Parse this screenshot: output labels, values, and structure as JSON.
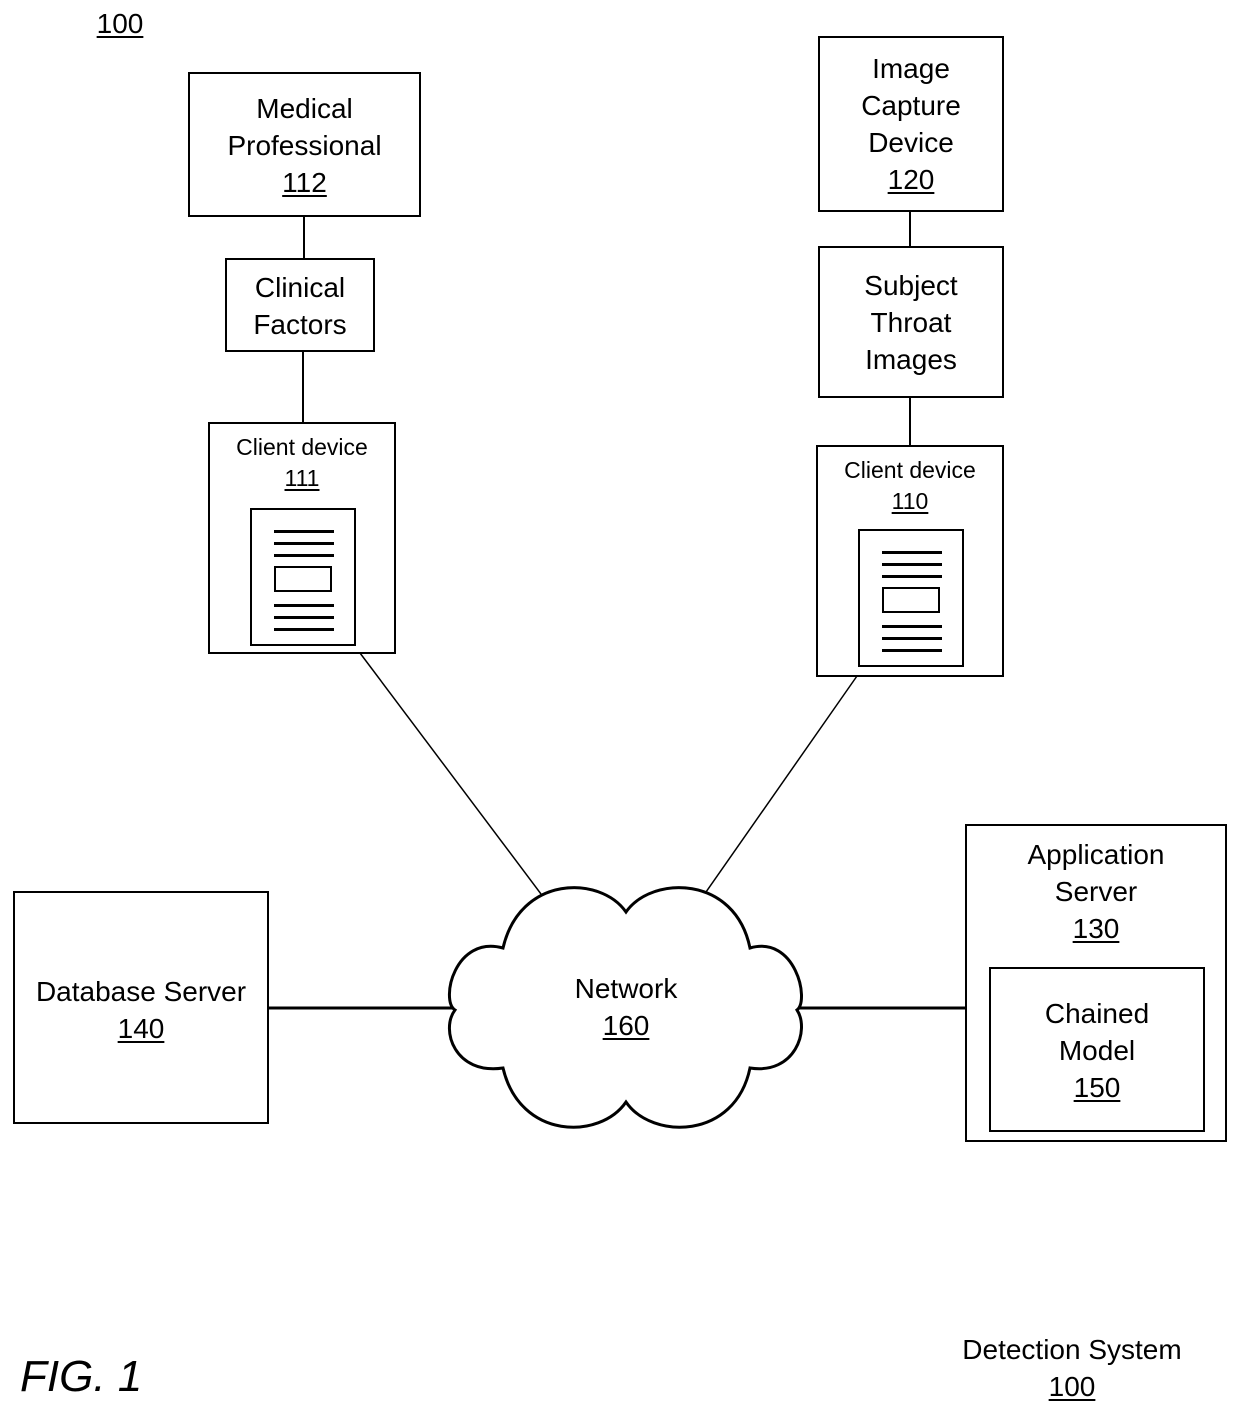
{
  "figure": {
    "top_ref": "100",
    "caption": "FIG. 1",
    "system_title": "Detection System",
    "system_ref": "100"
  },
  "nodes": {
    "medical_professional": {
      "lines": [
        "Medical",
        "Professional"
      ],
      "ref": "112"
    },
    "clinical_factors": {
      "lines": [
        "Clinical",
        "Factors"
      ]
    },
    "client_device_111": {
      "label": "Client device",
      "ref": "111"
    },
    "image_capture_device": {
      "lines": [
        "Image",
        "Capture",
        "Device"
      ],
      "ref": "120"
    },
    "subject_throat_images": {
      "lines": [
        "Subject",
        "Throat",
        "Images"
      ]
    },
    "client_device_110": {
      "label": "Client device",
      "ref": "110"
    },
    "database_server": {
      "label": "Database Server",
      "ref": "140"
    },
    "network": {
      "label": "Network",
      "ref": "160"
    },
    "application_server": {
      "lines": [
        "Application",
        "Server"
      ],
      "ref": "130"
    },
    "chained_model": {
      "lines": [
        "Chained",
        "Model"
      ],
      "ref": "150"
    }
  },
  "connections": [
    [
      "medical_professional",
      "clinical_factors"
    ],
    [
      "clinical_factors",
      "client_device_111"
    ],
    [
      "image_capture_device",
      "subject_throat_images"
    ],
    [
      "subject_throat_images",
      "client_device_110"
    ],
    [
      "client_device_111",
      "network"
    ],
    [
      "client_device_110",
      "network"
    ],
    [
      "database_server",
      "network"
    ],
    [
      "network",
      "application_server"
    ]
  ]
}
